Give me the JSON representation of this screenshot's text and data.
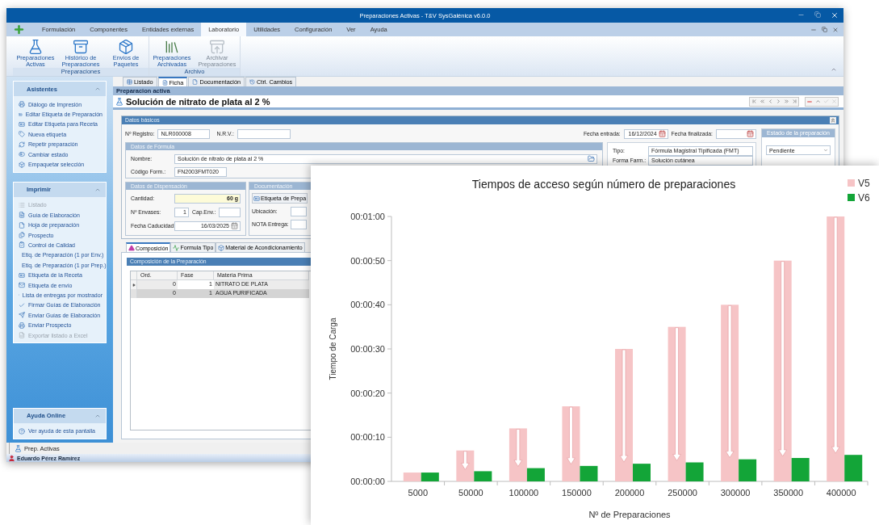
{
  "window": {
    "title": "Preparaciones Activas - T&V SysGalénica v6.0.0"
  },
  "menu": [
    {
      "label": "Formulación",
      "selected": false
    },
    {
      "label": "Componentes",
      "selected": false
    },
    {
      "label": "Entidades externas",
      "selected": false
    },
    {
      "label": "Laboratorio",
      "selected": true
    },
    {
      "label": "Utilidades",
      "selected": false
    },
    {
      "label": "Configuración",
      "selected": false
    },
    {
      "label": "Ver",
      "selected": false
    },
    {
      "label": "Ayuda",
      "selected": false
    }
  ],
  "ribbon_groups": [
    {
      "label": "Preparaciones",
      "buttons": [
        {
          "label": "Preparaciones Activas",
          "disabled": false
        },
        {
          "label": "Histórico de Preparaciones",
          "disabled": false
        },
        {
          "label": "Envíos de Paquetes",
          "disabled": false
        }
      ]
    },
    {
      "label": "Archivo",
      "buttons": [
        {
          "label": "Preparaciones Archivadas",
          "disabled": false
        },
        {
          "label": "Archivar Preparaciones",
          "disabled": true
        }
      ]
    }
  ],
  "sidebar": {
    "panels": [
      {
        "title": "Asistentes",
        "expanded": true,
        "items": [
          {
            "label": "Diálogo de Impresión",
            "disabled": false
          },
          {
            "label": "Editar Etiqueta de Preparación",
            "disabled": false
          },
          {
            "label": "Editar Etiqueta para Receta",
            "disabled": false
          },
          {
            "label": "Nueva etiqueta",
            "disabled": false
          },
          {
            "label": "Repetir preparación",
            "disabled": false
          },
          {
            "label": "Cambiar estado",
            "disabled": false
          },
          {
            "label": "Empaquetar selección",
            "disabled": false
          }
        ]
      },
      {
        "title": "Imprimir",
        "expanded": true,
        "items": [
          {
            "label": "Listado",
            "disabled": true
          },
          {
            "label": "Guía de Elaboración",
            "disabled": false
          },
          {
            "label": "Hoja de preparación",
            "disabled": false
          },
          {
            "label": "Prospecto",
            "disabled": false
          },
          {
            "label": "Control de Calidad",
            "disabled": false
          },
          {
            "label": "Etiq. de Preparación (1 por Env.)",
            "disabled": false
          },
          {
            "label": "Etiq. de Preparación (1 por Prep.)",
            "disabled": false
          },
          {
            "label": "Etiqueta de la Receta",
            "disabled": false
          },
          {
            "label": "Etiqueta de envío",
            "disabled": false
          },
          {
            "label": "Lista de entregas por mostrador",
            "disabled": false
          },
          {
            "label": "Firmar Guías de Elaboración",
            "disabled": false
          },
          {
            "label": "Enviar Guías de Elaboración",
            "disabled": false
          },
          {
            "label": "Enviar Prospecto",
            "disabled": false
          },
          {
            "label": "Exportar listado a Excel",
            "disabled": true
          }
        ]
      },
      {
        "title": "Ayuda Online",
        "expanded": true,
        "items": [
          {
            "label": "Ver ayuda de esta pantalla",
            "disabled": false
          }
        ]
      }
    ]
  },
  "document_tabs": [
    {
      "label": "Listado",
      "selected": false
    },
    {
      "label": "Ficha",
      "selected": true
    },
    {
      "label": "Documentación",
      "selected": false
    },
    {
      "label": "Ctrl. Cambios",
      "selected": false
    }
  ],
  "record": {
    "section": "Preparacion activa",
    "title": "Solución de nitrato de plata al 2 %"
  },
  "form": {
    "title": "Datos básicos",
    "registro": {
      "label": "Nº Registro:",
      "value": "NLR000008"
    },
    "nrv": {
      "label": "N.R.V.:"
    },
    "fecha_entrada": {
      "label": "Fecha entrada:",
      "value": "16/12/2024"
    },
    "fecha_finalizada": {
      "label": "Fecha finalizada:"
    },
    "formula": {
      "title": "Datos de Fórmula",
      "fields": [
        {
          "label": "Nombre:",
          "value": "Solución de nitrato de plata al 2 %"
        },
        {
          "label": "Código Form.:",
          "value": "FN2003FMT020"
        }
      ]
    },
    "type_info": [
      {
        "label": "Tipo:",
        "value": "Fórmula Magistral Tipificada (FMT)"
      },
      {
        "label": "Forma Farm.:",
        "value": "Solución cutánea"
      }
    ],
    "status": {
      "title": "Estado de la preparación",
      "value": "Pendiente"
    },
    "dispensing": {
      "title": "Datos de Dispensación",
      "cantidad": {
        "label": "Cantidad:",
        "value": "60 g"
      },
      "envases": {
        "label": "Nº Envases:",
        "value": "1"
      },
      "cap_env": {
        "label": "Cap.Env.:"
      },
      "caducidad": {
        "label": "Fecha Caducidad:",
        "value": "16/03/2025"
      }
    },
    "documentation": {
      "title": "Documentación",
      "button": "Etiqueta de Prepa",
      "fields": [
        {
          "label": "Ubicación:"
        },
        {
          "label": "NOTA Entrega:"
        }
      ]
    }
  },
  "detail_tabs": [
    {
      "label": "Composición",
      "selected": true
    },
    {
      "label": "Formula Tipo",
      "selected": false
    },
    {
      "label": "Material de Acondicionamiento",
      "selected": false
    }
  ],
  "composition": {
    "title": "Composición de la Preparación",
    "columns": [
      "Ord.",
      "Fase",
      "Materia Prima"
    ],
    "rows": [
      {
        "cells": [
          "0",
          "1",
          "NITRATO DE PLATA"
        ],
        "selected": true
      },
      {
        "cells": [
          "0",
          "1",
          "AGUA PURIFICADA"
        ],
        "selected": false
      }
    ]
  },
  "status_bar": {
    "module": "Prep. Activas",
    "user": "Eduardo Pérez Ramírez"
  },
  "chart": {
    "chart_data": {
      "type": "bar",
      "legend": "right",
      "title": "Tiempos de acceso según número de preparaciones",
      "xlabel": "Nº de Preparaciones",
      "ylabel": "Tiempo de Carga",
      "categories": [
        "5000",
        "50000",
        "100000",
        "150000",
        "200000",
        "250000",
        "300000",
        "350000",
        "400000"
      ],
      "series": [
        {
          "name": "V5",
          "color": "#f6c4c6",
          "values": [
            2,
            7,
            12,
            17,
            30,
            35,
            40,
            50,
            60
          ]
        },
        {
          "name": "V6",
          "color": "#13a538",
          "values": [
            2,
            2.3,
            3,
            3.5,
            4,
            4.3,
            5,
            5.3,
            6
          ]
        }
      ],
      "ylim": [
        0,
        60
      ],
      "yticks": [
        {
          "value": 0,
          "label": "00:00:00"
        },
        {
          "value": 10,
          "label": "00:00:10"
        },
        {
          "value": 20,
          "label": "00:00:20"
        },
        {
          "value": 30,
          "label": "00:00:30"
        },
        {
          "value": 40,
          "label": "00:00:40"
        },
        {
          "value": 50,
          "label": "00:00:50"
        },
        {
          "value": 60,
          "label": "00:01:00"
        }
      ]
    }
  }
}
